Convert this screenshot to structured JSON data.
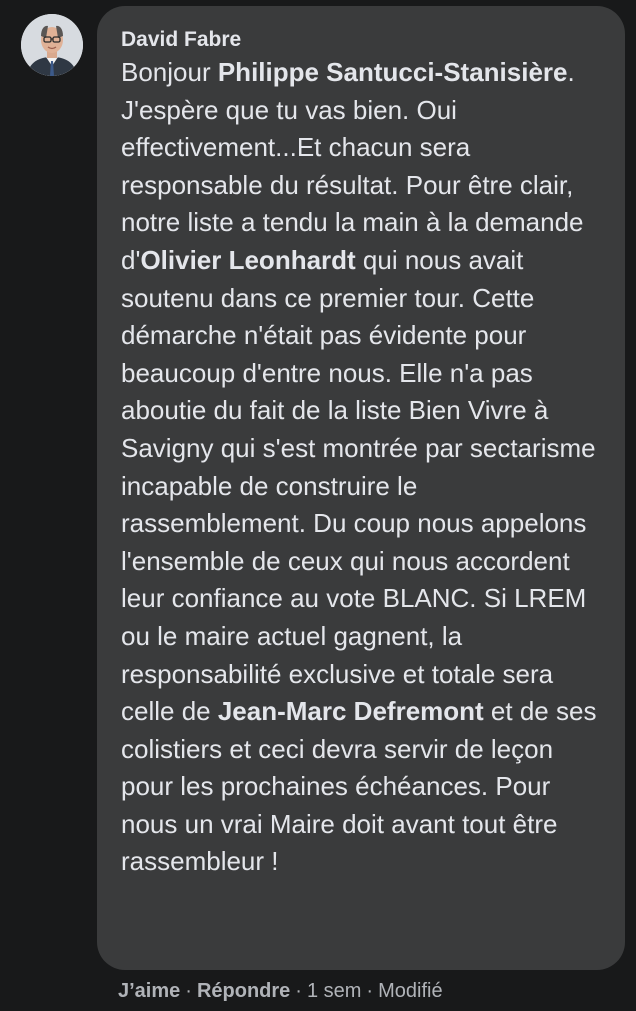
{
  "comment": {
    "author": "David Fabre",
    "segments": [
      {
        "text": "Bonjour ",
        "bold": false
      },
      {
        "text": "Philippe Santucci-Stanisière",
        "bold": true
      },
      {
        "text": ". J'espère que tu vas bien. Oui effectivement...Et chacun sera responsable du résultat. Pour être clair, notre liste a tendu la main à la demande d'",
        "bold": false
      },
      {
        "text": "Olivier Leonhardt",
        "bold": true
      },
      {
        "text": " qui nous avait soutenu dans ce premier tour. Cette démarche n'était pas évidente pour beaucoup d'entre nous. Elle n'a pas aboutie du fait de la liste Bien Vivre à Savigny qui s'est montrée par sectarisme incapable de construire le rassemblement. Du coup nous appelons l'ensemble de ceux qui nous accordent leur confiance au vote BLANC. Si LREM ou le maire actuel gagnent, la responsabilité exclusive et totale sera celle de ",
        "bold": false
      },
      {
        "text": "Jean-Marc Defremont",
        "bold": true
      },
      {
        "text": " et de ses colistiers et ceci devra servir de leçon pour les prochaines échéances. Pour nous un vrai Maire doit avant tout être rassembleur !",
        "bold": false
      }
    ]
  },
  "actions": {
    "like": "J’aime",
    "reply": "Répondre",
    "time": "1 sem",
    "edited": "Modifié",
    "separator": "·"
  },
  "colors": {
    "background": "#18191a",
    "bubble": "#3a3b3c",
    "text": "#e4e6eb",
    "secondary_text": "#b0b3b8"
  },
  "icons": {
    "avatar": "profile-photo-avatar"
  }
}
